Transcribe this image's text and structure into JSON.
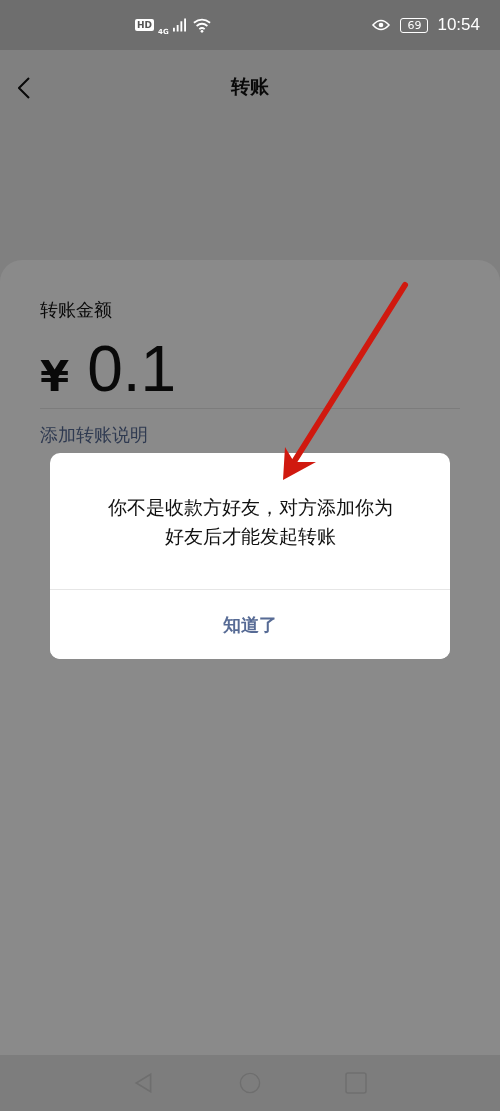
{
  "status_bar": {
    "hd_badge": "HD",
    "network": "4G",
    "battery": "69",
    "time": "10:54"
  },
  "header": {
    "title": "转账"
  },
  "transfer": {
    "amount_label": "转账金额",
    "currency": "¥",
    "amount": "0.1",
    "note_link": "添加转账说明"
  },
  "dialog": {
    "message": "你不是收款方好友，对方添加你为好友后才能发起转账",
    "button": "知道了"
  }
}
